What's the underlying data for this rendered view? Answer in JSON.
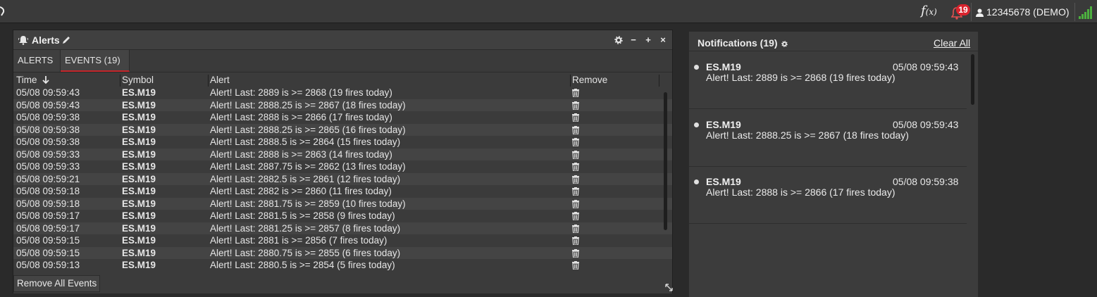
{
  "topbar": {
    "fx_label": "f",
    "fx_sub": "(x)",
    "notification_count": "19",
    "account_label": "12345678 (DEMO)"
  },
  "alerts_panel": {
    "title": "Alerts",
    "tabs": [
      {
        "label": "ALERTS"
      },
      {
        "label": "EVENTS (19)"
      }
    ],
    "columns": {
      "time": "Time",
      "symbol": "Symbol",
      "alert": "Alert",
      "remove": "Remove"
    },
    "rows": [
      {
        "time": "05/08 09:59:43",
        "symbol": "ES.M19",
        "alert": "Alert! Last: 2889 is >= 2868 (19 fires today)"
      },
      {
        "time": "05/08 09:59:43",
        "symbol": "ES.M19",
        "alert": "Alert! Last: 2888.25 is >= 2867 (18 fires today)"
      },
      {
        "time": "05/08 09:59:38",
        "symbol": "ES.M19",
        "alert": "Alert! Last: 2888 is >= 2866 (17 fires today)"
      },
      {
        "time": "05/08 09:59:38",
        "symbol": "ES.M19",
        "alert": "Alert! Last: 2888.25 is >= 2865 (16 fires today)"
      },
      {
        "time": "05/08 09:59:38",
        "symbol": "ES.M19",
        "alert": "Alert! Last: 2888.5 is >= 2864 (15 fires today)"
      },
      {
        "time": "05/08 09:59:33",
        "symbol": "ES.M19",
        "alert": "Alert! Last: 2888 is >= 2863 (14 fires today)"
      },
      {
        "time": "05/08 09:59:33",
        "symbol": "ES.M19",
        "alert": "Alert! Last: 2887.75 is >= 2862 (13 fires today)"
      },
      {
        "time": "05/08 09:59:21",
        "symbol": "ES.M19",
        "alert": "Alert! Last: 2882.5 is >= 2861 (12 fires today)"
      },
      {
        "time": "05/08 09:59:18",
        "symbol": "ES.M19",
        "alert": "Alert! Last: 2882 is >= 2860 (11 fires today)"
      },
      {
        "time": "05/08 09:59:18",
        "symbol": "ES.M19",
        "alert": "Alert! Last: 2881.75 is >= 2859 (10 fires today)"
      },
      {
        "time": "05/08 09:59:17",
        "symbol": "ES.M19",
        "alert": "Alert! Last: 2881.5 is >= 2858 (9 fires today)"
      },
      {
        "time": "05/08 09:59:17",
        "symbol": "ES.M19",
        "alert": "Alert! Last: 2881.25 is >= 2857 (8 fires today)"
      },
      {
        "time": "05/08 09:59:15",
        "symbol": "ES.M19",
        "alert": "Alert! Last: 2881 is >= 2856 (7 fires today)"
      },
      {
        "time": "05/08 09:59:15",
        "symbol": "ES.M19",
        "alert": "Alert! Last: 2880.75 is >= 2855 (6 fires today)"
      },
      {
        "time": "05/08 09:59:13",
        "symbol": "ES.M19",
        "alert": "Alert! Last: 2880.5 is >= 2854 (5 fires today)"
      }
    ],
    "remove_all_label": "Remove All Events"
  },
  "notifications": {
    "title": "Notifications (19)",
    "clear_all_label": "Clear All",
    "items": [
      {
        "symbol": "ES.M19",
        "time": "05/08 09:59:43",
        "message": "Alert! Last: 2889 is >= 2868 (19 fires today)"
      },
      {
        "symbol": "ES.M19",
        "time": "05/08 09:59:43",
        "message": "Alert! Last: 2888.25 is >= 2867 (18 fires today)"
      },
      {
        "symbol": "ES.M19",
        "time": "05/08 09:59:38",
        "message": "Alert! Last: 2888 is >= 2866 (17 fires today)"
      }
    ]
  },
  "colors": {
    "accent_red": "#c4262b",
    "badge_red": "#d9232d",
    "signal_green": "#4caf3f"
  },
  "icons": [
    "bell-icon",
    "pencil-icon",
    "gear-icon",
    "minimize-icon",
    "maximize-icon",
    "close-icon",
    "sort-down-icon",
    "trash-icon",
    "resize-icon",
    "user-icon",
    "signal-icon"
  ]
}
